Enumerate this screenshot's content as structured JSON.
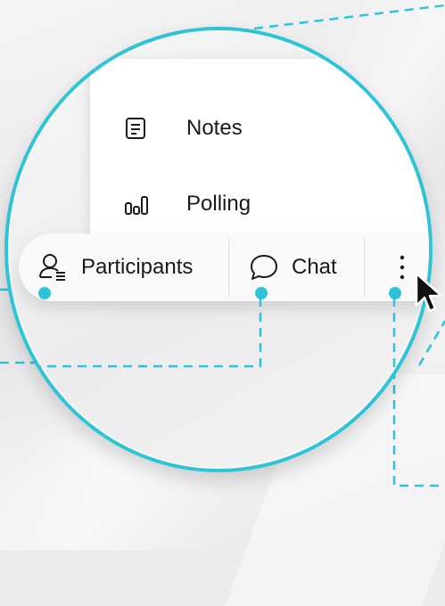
{
  "colors": {
    "accent": "#2ec4d6",
    "menu_bg": "#ffffff",
    "toolbar_bg": "#f9f9fa",
    "text": "#1a1a1a"
  },
  "overflow_menu": {
    "items": [
      {
        "label": "Notes",
        "icon": "notes-icon"
      },
      {
        "label": "Polling",
        "icon": "polling-icon"
      }
    ]
  },
  "toolbar": {
    "participants_label": "Participants",
    "participants_icon": "participants-icon",
    "chat_label": "Chat",
    "chat_icon": "chat-icon",
    "more_icon": "more-options-icon"
  }
}
